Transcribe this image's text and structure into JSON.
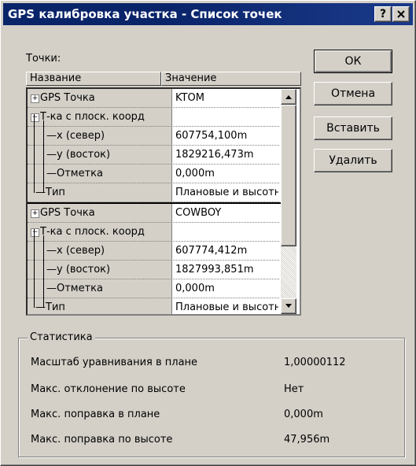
{
  "window": {
    "title": "GPS калибровка участка - Список точек",
    "help_button": "?",
    "close_button": "X"
  },
  "points_label": "Точки:",
  "columns": {
    "name": "Название",
    "value": "Значение"
  },
  "rows": [
    {
      "name": "GPS Точка",
      "value": "KTOM"
    },
    {
      "name": "Т-ка с плоск. коорд",
      "value": ""
    },
    {
      "name": "x (север)",
      "value": "607754,100m"
    },
    {
      "name": "y (восток)",
      "value": "1829216,473m"
    },
    {
      "name": "Отметка",
      "value": "0,000m"
    },
    {
      "name": "Тип",
      "value": "Плановые и высотные"
    },
    {
      "name": "GPS Точка",
      "value": "COWBOY"
    },
    {
      "name": "Т-ка с плоск. коорд",
      "value": ""
    },
    {
      "name": "x (север)",
      "value": "607774,412m"
    },
    {
      "name": "y (восток)",
      "value": "1827993,851m"
    },
    {
      "name": "Отметка",
      "value": "0,000m"
    },
    {
      "name": "Тип",
      "value": "Плановые и высотные"
    }
  ],
  "buttons": {
    "ok": "ОК",
    "cancel": "Отмена",
    "insert": "Вставить",
    "delete": "Удалить"
  },
  "stats": {
    "title": "Статистика",
    "items": [
      {
        "label": "Масштаб уравнивания в плане",
        "value": "1,00000112"
      },
      {
        "label": "Макс. отклонение по высоте",
        "value": "Нет"
      },
      {
        "label": "Макс. поправка в плане",
        "value": "0,000m"
      },
      {
        "label": "Макс. поправка по высоте",
        "value": "47,956m"
      }
    ]
  }
}
